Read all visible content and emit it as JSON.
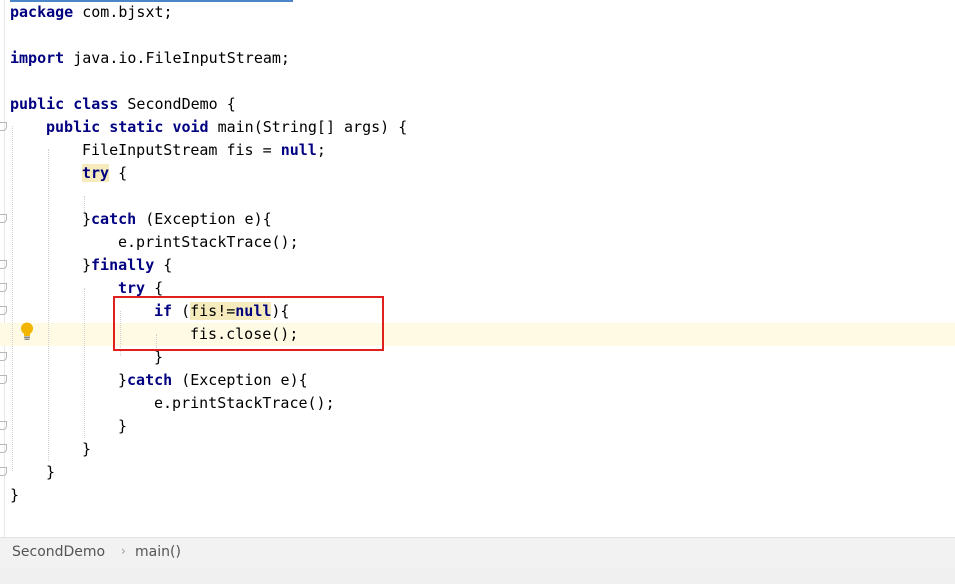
{
  "editor": {
    "language": "Java",
    "highlight_color": "#e0201a",
    "lines": {
      "l1": [
        "package",
        " com.bjsxt;"
      ],
      "l3": [
        "import",
        " java.io.FileInputStream;"
      ],
      "l5": [
        "public",
        " ",
        "class",
        " SecondDemo {"
      ],
      "l6": [
        "public",
        " ",
        "static",
        " ",
        "void",
        " main(String[] args) {"
      ],
      "l7": [
        "FileInputStream fis = ",
        "null",
        ";"
      ],
      "l8": [
        "try",
        " {"
      ],
      "l10": [
        "}",
        "catch",
        " (Exception e){"
      ],
      "l11": [
        "e.printStackTrace();"
      ],
      "l12": [
        "}",
        "finally",
        " {"
      ],
      "l13": [
        "try",
        " {"
      ],
      "l14": [
        "if",
        " (",
        "fis!=",
        "null",
        "){"
      ],
      "l15": [
        "fis.close();"
      ],
      "l16": [
        "}"
      ],
      "l17": [
        "}",
        "catch",
        " (Exception e){"
      ],
      "l18": [
        "e.printStackTrace();"
      ],
      "l19": [
        "}"
      ],
      "l20": [
        "}"
      ],
      "l21": [
        "}"
      ],
      "l22": [
        "}"
      ]
    }
  },
  "breadcrumb": {
    "class_name": "SecondDemo",
    "separator": "›",
    "method_name": "main()"
  },
  "icons": {
    "bulb": "lightbulb-icon",
    "fold": "fold-marker-icon"
  }
}
